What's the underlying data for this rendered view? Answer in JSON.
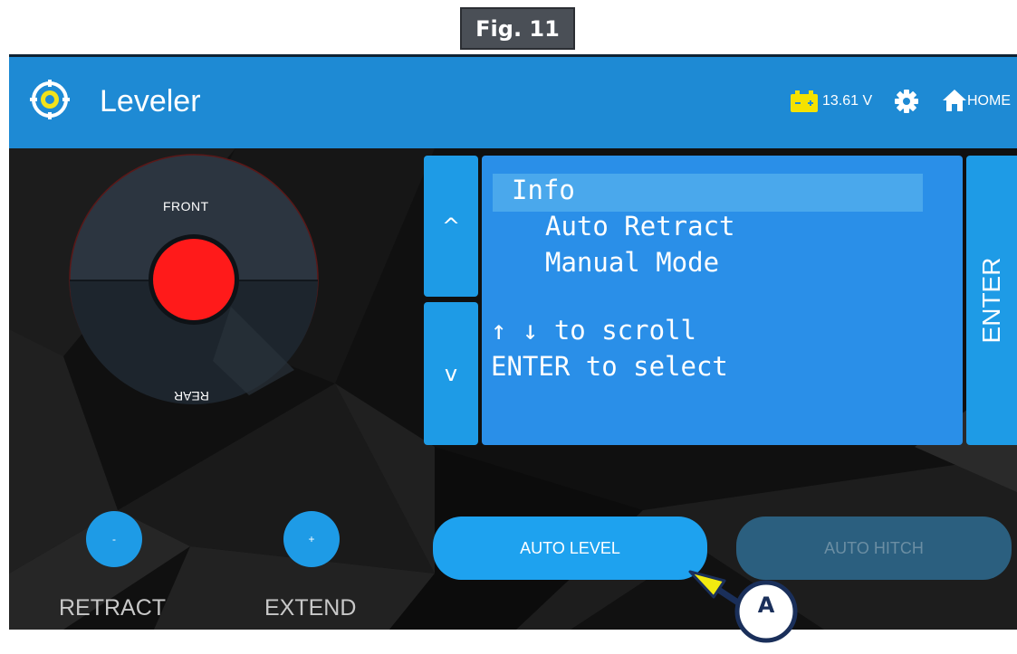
{
  "figure": {
    "label": "Fig. 11"
  },
  "header": {
    "title": "Leveler",
    "voltage": "13.61 V",
    "home_label": "HOME",
    "icons": {
      "logo": "leveler-target-icon",
      "battery": "battery-icon",
      "settings": "gear-icon",
      "home": "home-icon"
    }
  },
  "compass": {
    "front_label": "FRONT",
    "rear_label": "REAR",
    "level_indicator_color": "#ff1a1a"
  },
  "menu": {
    "up_label": "^",
    "down_label": "v",
    "lines": [
      "Info",
      "Auto Retract",
      "Manual Mode"
    ],
    "selected_index": 0,
    "hint_scroll": "↑ ↓ to scroll",
    "hint_select": "ENTER to select",
    "enter_label": "ENTER"
  },
  "controls": {
    "retract_symbol": "-",
    "extend_symbol": "+",
    "retract_label": "RETRACT",
    "extend_label": "EXTEND",
    "auto_level_label": "AUTO LEVEL",
    "auto_hitch_label": "AUTO HITCH"
  },
  "callout": {
    "letter": "A",
    "arrow_color": "#f2ea10",
    "ring_color": "#1a2f5a"
  },
  "colors": {
    "header": "#1e8ad4",
    "accent": "#1e9be6",
    "lcd": "#2a8fe8",
    "disabled": "#2b5f7f"
  }
}
